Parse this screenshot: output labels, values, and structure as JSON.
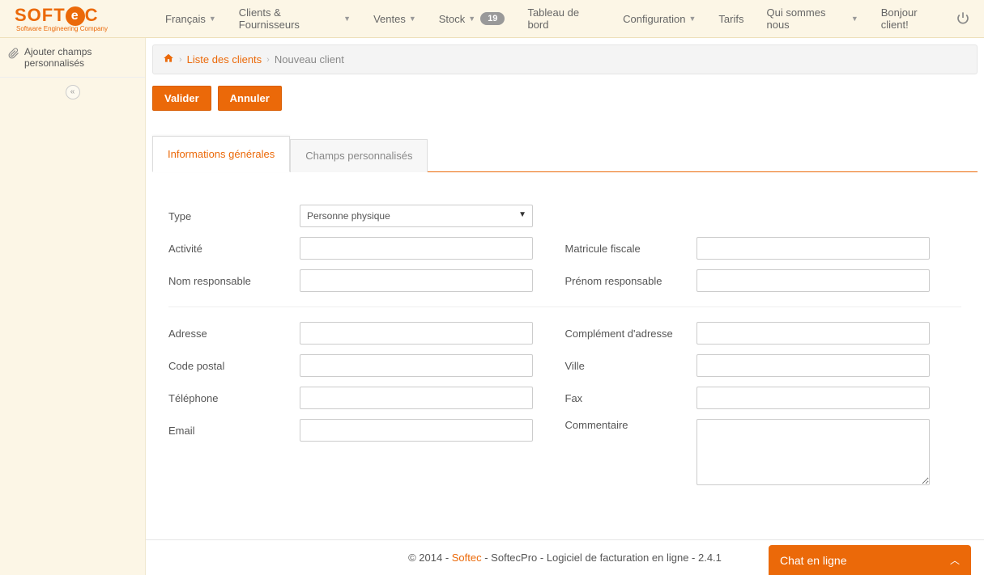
{
  "logo": {
    "text": "SOFTEC",
    "sub": "Software Engineering Company"
  },
  "nav": {
    "lang": "Français",
    "clients": "Clients & Fournisseurs",
    "ventes": "Ventes",
    "stock": "Stock",
    "stock_badge": "19",
    "dashboard": "Tableau de bord",
    "config": "Configuration",
    "tarifs": "Tarifs",
    "about": "Qui sommes nous",
    "greeting": "Bonjour client!"
  },
  "sidebar": {
    "add_custom_fields": "Ajouter champs personnalisés"
  },
  "breadcrumb": {
    "list": "Liste des clients",
    "current": "Nouveau client"
  },
  "actions": {
    "validate": "Valider",
    "cancel": "Annuler"
  },
  "tabs": {
    "general": "Informations générales",
    "custom": "Champs personnalisés"
  },
  "form": {
    "type": {
      "label": "Type",
      "value": "Personne physique"
    },
    "activite": {
      "label": "Activité"
    },
    "matricule": {
      "label": "Matricule fiscale"
    },
    "nom_resp": {
      "label": "Nom responsable"
    },
    "prenom_resp": {
      "label": "Prénom responsable"
    },
    "adresse": {
      "label": "Adresse"
    },
    "compl_adresse": {
      "label": "Complément d'adresse"
    },
    "code_postal": {
      "label": "Code postal"
    },
    "ville": {
      "label": "Ville"
    },
    "telephone": {
      "label": "Téléphone"
    },
    "fax": {
      "label": "Fax"
    },
    "email": {
      "label": "Email"
    },
    "commentaire": {
      "label": "Commentaire"
    }
  },
  "footer": {
    "copyright": "© 2014 - ",
    "brand": "Softec",
    "rest": " - SoftecPro - Logiciel de facturation en ligne - 2.4.1"
  },
  "chat": {
    "label": "Chat en ligne"
  }
}
